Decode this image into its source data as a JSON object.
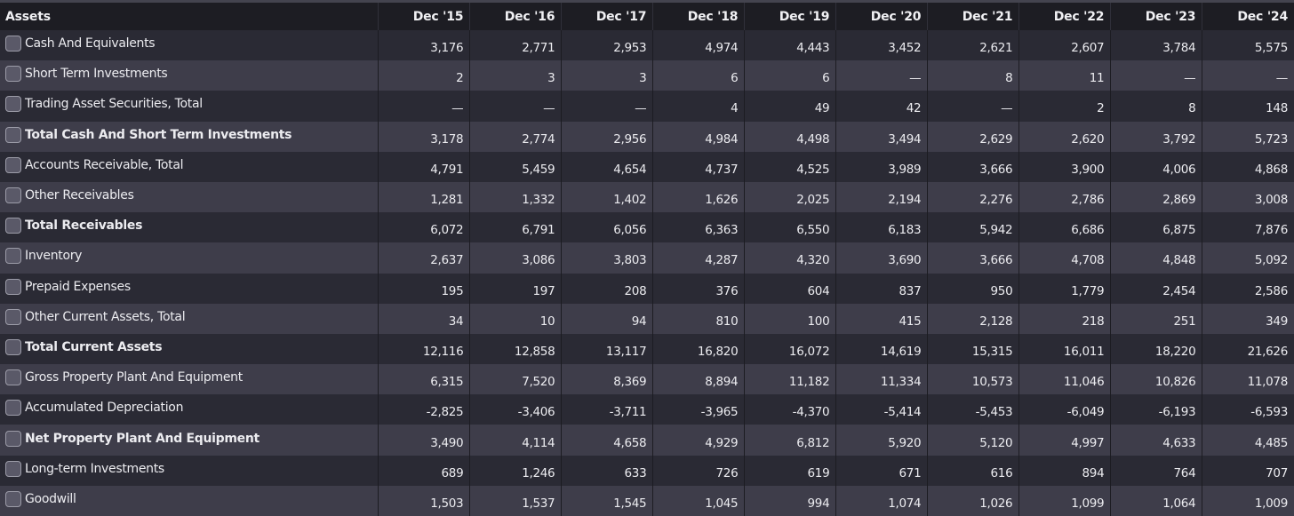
{
  "table": {
    "header": {
      "label": "Assets",
      "periods": [
        "Dec '15",
        "Dec '16",
        "Dec '17",
        "Dec '18",
        "Dec '19",
        "Dec '20",
        "Dec '21",
        "Dec '22",
        "Dec '23",
        "Dec '24"
      ]
    },
    "rows": [
      {
        "label": "Cash And Equivalents",
        "bold": false,
        "values": [
          "3,176",
          "2,771",
          "2,953",
          "4,974",
          "4,443",
          "3,452",
          "2,621",
          "2,607",
          "3,784",
          "5,575"
        ]
      },
      {
        "label": "Short Term Investments",
        "bold": false,
        "values": [
          "2",
          "3",
          "3",
          "6",
          "6",
          "—",
          "8",
          "11",
          "—",
          "—"
        ]
      },
      {
        "label": "Trading Asset Securities, Total",
        "bold": false,
        "values": [
          "—",
          "—",
          "—",
          "4",
          "49",
          "42",
          "—",
          "2",
          "8",
          "148"
        ]
      },
      {
        "label": "Total Cash And Short Term Investments",
        "bold": true,
        "values": [
          "3,178",
          "2,774",
          "2,956",
          "4,984",
          "4,498",
          "3,494",
          "2,629",
          "2,620",
          "3,792",
          "5,723"
        ]
      },
      {
        "label": "Accounts Receivable, Total",
        "bold": false,
        "values": [
          "4,791",
          "5,459",
          "4,654",
          "4,737",
          "4,525",
          "3,989",
          "3,666",
          "3,900",
          "4,006",
          "4,868"
        ]
      },
      {
        "label": "Other Receivables",
        "bold": false,
        "values": [
          "1,281",
          "1,332",
          "1,402",
          "1,626",
          "2,025",
          "2,194",
          "2,276",
          "2,786",
          "2,869",
          "3,008"
        ]
      },
      {
        "label": "Total Receivables",
        "bold": true,
        "values": [
          "6,072",
          "6,791",
          "6,056",
          "6,363",
          "6,550",
          "6,183",
          "5,942",
          "6,686",
          "6,875",
          "7,876"
        ]
      },
      {
        "label": "Inventory",
        "bold": false,
        "values": [
          "2,637",
          "3,086",
          "3,803",
          "4,287",
          "4,320",
          "3,690",
          "3,666",
          "4,708",
          "4,848",
          "5,092"
        ]
      },
      {
        "label": "Prepaid Expenses",
        "bold": false,
        "values": [
          "195",
          "197",
          "208",
          "376",
          "604",
          "837",
          "950",
          "1,779",
          "2,454",
          "2,586"
        ]
      },
      {
        "label": "Other Current Assets, Total",
        "bold": false,
        "values": [
          "34",
          "10",
          "94",
          "810",
          "100",
          "415",
          "2,128",
          "218",
          "251",
          "349"
        ]
      },
      {
        "label": "Total Current Assets",
        "bold": true,
        "values": [
          "12,116",
          "12,858",
          "13,117",
          "16,820",
          "16,072",
          "14,619",
          "15,315",
          "16,011",
          "18,220",
          "21,626"
        ]
      },
      {
        "label": "Gross Property Plant And Equipment",
        "bold": false,
        "values": [
          "6,315",
          "7,520",
          "8,369",
          "8,894",
          "11,182",
          "11,334",
          "10,573",
          "11,046",
          "10,826",
          "11,078"
        ]
      },
      {
        "label": "Accumulated Depreciation",
        "bold": false,
        "values": [
          "-2,825",
          "-3,406",
          "-3,711",
          "-3,965",
          "-4,370",
          "-5,414",
          "-5,453",
          "-6,049",
          "-6,193",
          "-6,593"
        ]
      },
      {
        "label": "Net Property Plant And Equipment",
        "bold": true,
        "values": [
          "3,490",
          "4,114",
          "4,658",
          "4,929",
          "6,812",
          "5,920",
          "5,120",
          "4,997",
          "4,633",
          "4,485"
        ]
      },
      {
        "label": "Long-term Investments",
        "bold": false,
        "values": [
          "689",
          "1,246",
          "633",
          "726",
          "619",
          "671",
          "616",
          "894",
          "764",
          "707"
        ]
      },
      {
        "label": "Goodwill",
        "bold": false,
        "values": [
          "1,503",
          "1,537",
          "1,545",
          "1,045",
          "994",
          "1,074",
          "1,026",
          "1,099",
          "1,064",
          "1,009"
        ]
      }
    ]
  },
  "colors": {
    "header_bg": "#1d1d23",
    "row_dark": "#2a2a34",
    "row_light": "#3e3d4a",
    "text": "#f1f1f4",
    "checkbox": "#5a5968"
  }
}
